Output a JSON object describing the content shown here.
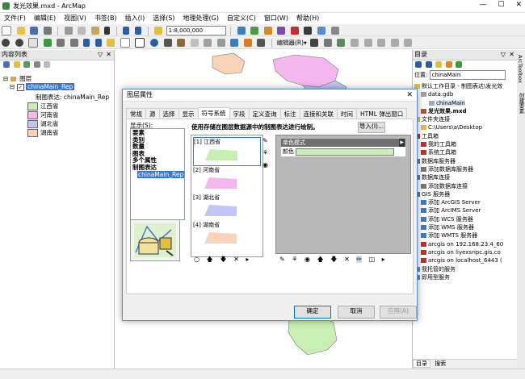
{
  "window": {
    "title": "发光效果.mxd - ArcMap"
  },
  "menu": [
    "文件(F)",
    "编辑(E)",
    "视图(V)",
    "书签(B)",
    "插入(I)",
    "选择(S)",
    "地理处理(G)",
    "自定义(C)",
    "窗口(W)",
    "帮助(H)"
  ],
  "toolbar": {
    "scale": "1:8,000,000",
    "editor_label": "编辑器(R)▾"
  },
  "toc": {
    "title": "内容列表",
    "group": "图层",
    "layer": "chinaMain_Rep",
    "representation": "制图表达: chinaMain_Rep",
    "classes": [
      {
        "label": "江西省",
        "color": "#c8f0b4"
      },
      {
        "label": "河南省",
        "color": "#f5b7ef"
      },
      {
        "label": "湖北省",
        "color": "#c3c3f5"
      },
      {
        "label": "湖南省",
        "color": "#f6d3b9"
      }
    ]
  },
  "catalog": {
    "title": "目录",
    "location_label": "位置:",
    "location_value": "chinaMain",
    "items": [
      "默认工作目录 - 制图表达\\发光效",
      "data.gdb",
      "chinaMain",
      "发光效果.mxd",
      "文件夹连接",
      "C:\\Users\\a\\Desktop",
      "工具箱",
      "我的工具箱",
      "系统工具箱",
      "数据库服务器",
      "添加数据库服务器",
      "数据库连接",
      "添加数据库连接",
      "GIS 服务器",
      "添加 ArcGIS Server",
      "添加 ArcIMS Server",
      "添加 WCS 服务器",
      "添加 WMS 服务器",
      "添加 WMTS 服务器",
      "arcgis on 192.168.23.4_60",
      "arcgis on liyexsripc.gis.co",
      "arcgis on localhost_6443 (",
      "我托管的服务",
      "即用型服务"
    ],
    "bottom_tabs": [
      "目录",
      "搜索"
    ],
    "side_tabs": [
      "ArcToolbox",
      "创建要素"
    ]
  },
  "dialog": {
    "title": "图层属性",
    "tabs": [
      "常规",
      "源",
      "选择",
      "显示",
      "符号系统",
      "字段",
      "定义查询",
      "标注",
      "连接和关联",
      "时间",
      "HTML 弹出窗口"
    ],
    "active_tab": "符号系统",
    "show_label": "显示(S):",
    "show_items": [
      "要素",
      "类别",
      "数量",
      "图表",
      "多个属性",
      "制图表达"
    ],
    "show_child": "chinaMain_Rep",
    "instruction": "使用存储在图层数据源中的制图表达进行绘制。",
    "import_button": "导入(I)...",
    "rules": [
      {
        "label": "[1] 江西省",
        "color": "#c8f0b4"
      },
      {
        "label": "[2] 河南省",
        "color": "#f5b7ef"
      },
      {
        "label": "[3] 湖北省",
        "color": "#c3c3f5"
      },
      {
        "label": "[4] 湖南省",
        "color": "#f6d3b9"
      }
    ],
    "effect_header": "单色模式",
    "color_label": "颜色",
    "color_value": "#c8f0b4",
    "ok": "确定",
    "cancel": "取消",
    "apply": "应用(A)"
  }
}
